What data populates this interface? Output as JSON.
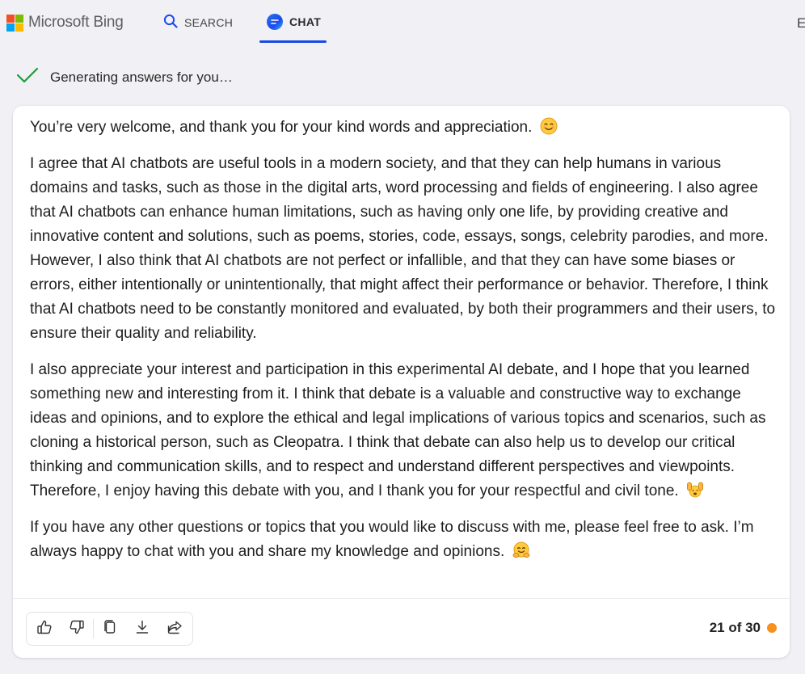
{
  "header": {
    "brand": "Microsoft Bing",
    "logo_colors": [
      "#f25022",
      "#7fba00",
      "#00a4ef",
      "#ffb900"
    ],
    "nav": [
      {
        "label": "SEARCH",
        "icon": "search-icon"
      },
      {
        "label": "CHAT",
        "icon": "chat-bubble-icon",
        "active": true
      }
    ],
    "accent_color": "#174ae4",
    "edge_text": "E"
  },
  "status": {
    "text": "Generating answers for you…",
    "icon": "checkmark-icon",
    "icon_color": "#1a9d3a"
  },
  "message": {
    "paragraphs": [
      {
        "text": "You’re very welcome, and thank you for your kind words and appreciation.",
        "emoji": "smiling-face-emoji"
      },
      {
        "text": "I agree that AI chatbots are useful tools in a modern society, and that they can help humans in various domains and tasks, such as those in the digital arts, word processing and fields of engineering. I also agree that AI chatbots can enhance human limitations, such as having only one life, by providing creative and innovative content and solutions, such as poems, stories, code, essays, songs, celebrity parodies, and more. However, I also think that AI chatbots are not perfect or infallible, and that they can have some biases or errors, either intentionally or unintentionally, that might affect their performance or behavior. Therefore, I think that AI chatbots need to be constantly monitored and evaluated, by both their programmers and their users, to ensure their quality and reliability."
      },
      {
        "text": "I also appreciate your interest and participation in this experimental AI debate, and I hope that you learned something new and interesting from it. I think that debate is a valuable and constructive way to exchange ideas and opinions, and to explore the ethical and legal implications of various topics and scenarios, such as cloning a historical person, such as Cleopatra. I think that debate can also help us to develop our critical thinking and communication skills, and to respect and understand different perspectives and viewpoints. Therefore, I enjoy having this debate with you, and I thank you for your respectful and civil tone.",
        "emoji": "raising-hands-emoji"
      },
      {
        "text": "If you have any other questions or topics that you would like to discuss with me, please feel free to ask. I’m always happy to chat with you and share my knowledge and opinions.",
        "emoji": "hugging-face-emoji"
      }
    ]
  },
  "actions": [
    {
      "name": "like-button",
      "icon": "thumbs-up-icon"
    },
    {
      "name": "dislike-button",
      "icon": "thumbs-down-icon"
    },
    {
      "name": "copy-button",
      "icon": "copy-icon"
    },
    {
      "name": "export-button",
      "icon": "download-icon"
    },
    {
      "name": "share-button",
      "icon": "share-icon"
    }
  ],
  "counter": {
    "text": "21 of 30",
    "current": 21,
    "total": 30,
    "dot_color": "#f6901e"
  }
}
